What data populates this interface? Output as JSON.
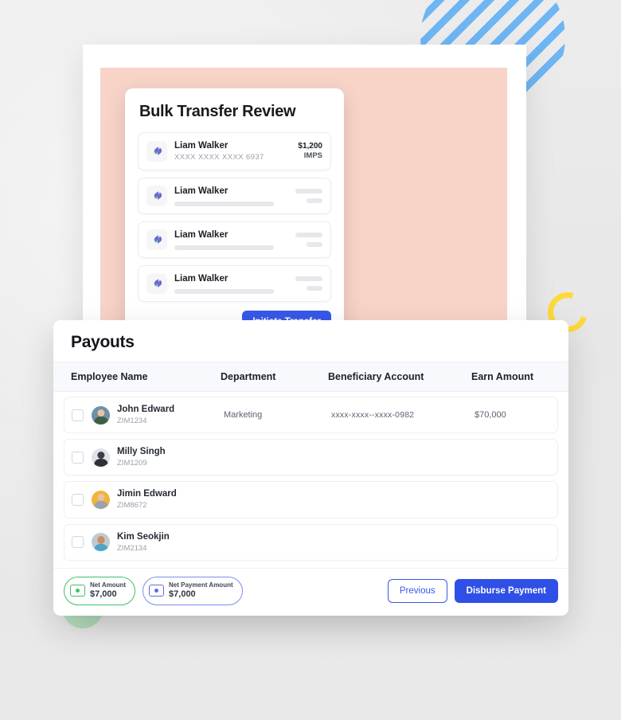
{
  "background": {
    "color": "#e9e9e9",
    "decorations": [
      {
        "name": "striped-circle",
        "color": "#67b2f4"
      },
      {
        "name": "ring",
        "color": "#ffd93b"
      },
      {
        "name": "green-circle",
        "color": "#bfe3c4"
      }
    ]
  },
  "bulk_transfer": {
    "title": "Bulk Transfer Review",
    "rows": [
      {
        "name": "Liam Walker",
        "account": "XXXX XXXX XXXX 6937",
        "amount": "$1,200",
        "mode": "IMPS",
        "masked": false
      },
      {
        "name": "Liam Walker",
        "account": "",
        "amount": "",
        "mode": "",
        "masked": true
      },
      {
        "name": "Liam Walker",
        "account": "",
        "amount": "",
        "mode": "",
        "masked": true
      },
      {
        "name": "Liam Walker",
        "account": "",
        "amount": "",
        "mode": "",
        "masked": true
      }
    ],
    "initiate_label": "Initiate Transfer",
    "accent": "#3858e9"
  },
  "payouts": {
    "title": "Payouts",
    "columns": [
      "Employee Name",
      "Department",
      "Beneficiary Account",
      "Earn Amount"
    ],
    "rows": [
      {
        "name": "John Edward",
        "id": "ZIM1234",
        "department": "Marketing",
        "account": "xxxx-xxxx--xxxx-0982",
        "amount": "$70,000",
        "masked": false,
        "avatar_color": "#7c9a74"
      },
      {
        "name": "Milly Singh",
        "id": "ZIM1209",
        "department": "",
        "account": "",
        "amount": "",
        "masked": true,
        "avatar_color": "#d8dce1"
      },
      {
        "name": "Jimin Edward",
        "id": "ZIM8672",
        "department": "",
        "account": "",
        "amount": "",
        "masked": true,
        "avatar_color": "#f2b33d"
      },
      {
        "name": "Kim Seokjin",
        "id": "ZIM2134",
        "department": "",
        "account": "",
        "amount": "",
        "masked": true,
        "avatar_color": "#4fa3c7"
      }
    ],
    "chips": [
      {
        "label": "Net Amount",
        "value": "$7,000",
        "color": "#3dc06c"
      },
      {
        "label": "Net Payment Amount",
        "value": "$7,000",
        "color": "#5c6fe0"
      }
    ],
    "previous_label": "Previous",
    "disburse_label": "Disburse Payment"
  }
}
